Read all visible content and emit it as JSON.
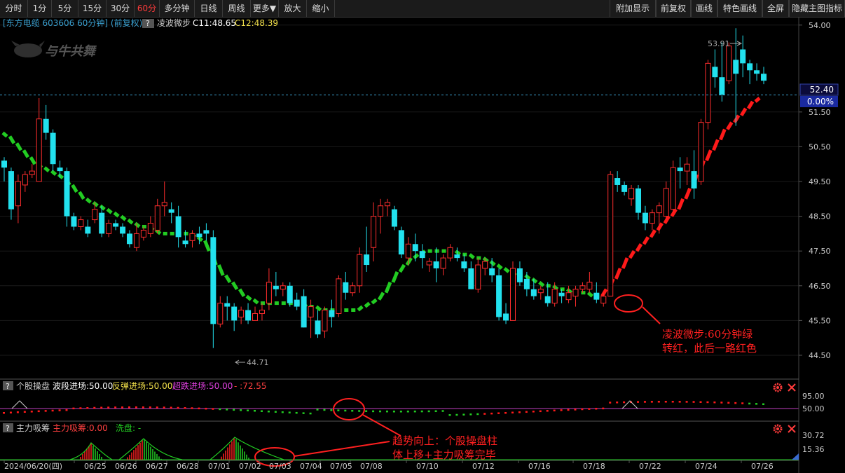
{
  "toolbar": {
    "left": [
      "分时",
      "1分",
      "5分",
      "15分",
      "30分",
      "60分",
      "多分钟",
      "日线",
      "周线",
      "更多▼",
      "放大",
      "缩小"
    ],
    "active": "60分",
    "right": [
      "附加显示",
      "前复权",
      "画线",
      "特色画线",
      "全屏",
      "隐藏主图指标"
    ]
  },
  "colors": {
    "up": "#ff2d2d",
    "down": "#22e1ee",
    "indicator_red": "#ff1a1a",
    "indicator_green": "#22cc22",
    "price_line": "#3aa0d0",
    "background": "#000000"
  },
  "main_header": {
    "stock": "[东方电缆 603606 60分钟] (前复权)",
    "help": "?",
    "indicator": "凌波微步",
    "c1": "C11:48.65",
    "c2": "C12:48.39"
  },
  "watermark": "与牛共舞",
  "price_axis": {
    "ticks": [
      "54.00",
      "51.50",
      "50.50",
      "49.50",
      "48.50",
      "47.50",
      "46.50",
      "45.50",
      "44.50"
    ]
  },
  "last_price": {
    "value": "52.40",
    "change": "0.00%"
  },
  "annotations": {
    "high": "53.91",
    "low": "44.71",
    "note1_line1": "凌波微步:60分钟绿",
    "note1_line2": "转红，此后一路红色",
    "note2_line1": "趋势向上：个股操盘柱",
    "note2_line2": "体上移+主力吸筹完毕"
  },
  "panel2": {
    "help": "?",
    "name": "个股操盘",
    "t1": "波段进场:50.00",
    "t2": "反弹进场:50.00",
    "t3": "超跌进场:50.00",
    "t4": "- :72.55",
    "tick1": "95.00",
    "tick2": "50.00"
  },
  "panel3": {
    "help": "?",
    "name": "主力吸筹",
    "t1": "主力吸筹:0.00",
    "t2": "洗盘: -",
    "tick1": "30.72",
    "tick2": "15.36"
  },
  "dates": [
    "2024/06/20(四)",
    "06/25",
    "06/26",
    "06/27",
    "06/28",
    "07/01",
    "07/02",
    "07/03",
    "07/04",
    "07/05",
    "07/08",
    "07/10",
    "07/12",
    "07/16",
    "07/18",
    "07/22",
    "07/24",
    "07/26"
  ],
  "chart_data": {
    "type": "candlestick",
    "title": "东方电缆 603606 60分钟",
    "ylim": [
      44.0,
      54.5
    ],
    "candles": [
      [
        50.1,
        50.2,
        49.5,
        49.9
      ],
      [
        49.8,
        49.9,
        48.4,
        48.7
      ],
      [
        48.8,
        49.7,
        48.3,
        49.5
      ],
      [
        49.4,
        49.8,
        49.2,
        49.7
      ],
      [
        49.7,
        50.0,
        49.6,
        49.8
      ],
      [
        49.5,
        51.9,
        49.5,
        51.3
      ],
      [
        51.3,
        51.7,
        50.7,
        50.9
      ],
      [
        50.9,
        51.0,
        49.8,
        50.0
      ],
      [
        49.9,
        50.1,
        49.6,
        49.8
      ],
      [
        49.8,
        49.9,
        48.2,
        48.5
      ],
      [
        48.5,
        48.6,
        48.1,
        48.2
      ],
      [
        48.2,
        48.5,
        48.1,
        48.4
      ],
      [
        48.2,
        48.4,
        47.9,
        48.0
      ],
      [
        48.4,
        48.9,
        48.3,
        48.7
      ],
      [
        48.6,
        48.8,
        47.9,
        48.0
      ],
      [
        48.0,
        48.4,
        47.9,
        48.3
      ],
      [
        48.3,
        48.4,
        48.1,
        48.2
      ],
      [
        48.2,
        48.3,
        47.9,
        48.0
      ],
      [
        48.0,
        48.1,
        47.6,
        47.7
      ],
      [
        47.6,
        48.3,
        47.5,
        48.0
      ],
      [
        47.9,
        48.2,
        47.8,
        48.1
      ],
      [
        48.0,
        48.5,
        47.9,
        48.3
      ],
      [
        48.1,
        49.0,
        48.0,
        48.8
      ],
      [
        48.8,
        49.5,
        48.5,
        48.9
      ],
      [
        48.7,
        48.9,
        48.3,
        48.6
      ],
      [
        48.5,
        48.8,
        47.6,
        47.9
      ],
      [
        47.8,
        48.1,
        47.6,
        47.7
      ],
      [
        47.8,
        48.1,
        47.6,
        48.0
      ],
      [
        48.0,
        48.2,
        47.7,
        47.9
      ],
      [
        48.1,
        48.3,
        47.8,
        48.0
      ],
      [
        47.9,
        48.1,
        44.71,
        45.4
      ],
      [
        45.4,
        46.2,
        45.3,
        46.0
      ],
      [
        46.0,
        46.2,
        45.5,
        45.9
      ],
      [
        45.9,
        46.0,
        45.2,
        45.5
      ],
      [
        45.6,
        45.9,
        45.4,
        45.8
      ],
      [
        45.8,
        46.0,
        45.4,
        45.5
      ],
      [
        45.5,
        45.9,
        45.5,
        45.7
      ],
      [
        45.7,
        46.0,
        45.5,
        45.8
      ],
      [
        46.0,
        47.0,
        45.8,
        46.6
      ],
      [
        46.5,
        46.9,
        46.2,
        46.4
      ],
      [
        46.4,
        46.6,
        46.2,
        46.5
      ],
      [
        46.5,
        46.6,
        45.9,
        46.0
      ],
      [
        46.1,
        46.3,
        45.8,
        45.9
      ],
      [
        46.2,
        46.4,
        45.3,
        45.3
      ],
      [
        45.6,
        46.1,
        45.0,
        45.9
      ],
      [
        45.5,
        45.8,
        45.0,
        45.1
      ],
      [
        45.2,
        45.9,
        45.0,
        45.8
      ],
      [
        45.8,
        46.1,
        45.3,
        45.6
      ],
      [
        45.7,
        46.8,
        45.6,
        46.7
      ],
      [
        46.6,
        46.9,
        46.1,
        46.3
      ],
      [
        46.3,
        46.6,
        46.2,
        46.5
      ],
      [
        46.5,
        47.6,
        46.3,
        47.4
      ],
      [
        47.4,
        48.2,
        46.9,
        47.1
      ],
      [
        47.6,
        48.9,
        47.2,
        48.5
      ],
      [
        48.5,
        49.0,
        48.0,
        48.8
      ],
      [
        48.8,
        49.0,
        48.5,
        48.9
      ],
      [
        48.7,
        48.8,
        48.1,
        48.2
      ],
      [
        48.1,
        48.2,
        47.3,
        47.4
      ],
      [
        47.3,
        47.9,
        47.1,
        47.7
      ],
      [
        47.7,
        48.0,
        47.2,
        47.5
      ],
      [
        47.5,
        47.7,
        47.0,
        47.3
      ],
      [
        47.1,
        47.3,
        46.9,
        47.2
      ],
      [
        47.2,
        47.6,
        46.6,
        47.0
      ],
      [
        47.0,
        47.4,
        46.8,
        47.3
      ],
      [
        47.3,
        47.7,
        47.2,
        47.6
      ],
      [
        47.4,
        47.6,
        47.2,
        47.3
      ],
      [
        47.2,
        47.4,
        46.9,
        47.0
      ],
      [
        47.0,
        47.2,
        46.4,
        46.4
      ],
      [
        46.4,
        47.3,
        46.3,
        47.1
      ],
      [
        47.0,
        47.3,
        46.8,
        47.2
      ],
      [
        47.0,
        47.3,
        46.6,
        46.8
      ],
      [
        46.8,
        47.0,
        45.5,
        45.6
      ],
      [
        45.7,
        46.0,
        45.4,
        45.5
      ],
      [
        45.5,
        47.2,
        45.5,
        47.0
      ],
      [
        47.0,
        47.2,
        46.5,
        46.6
      ],
      [
        46.7,
        46.9,
        46.2,
        46.4
      ],
      [
        46.4,
        46.7,
        46.1,
        46.2
      ],
      [
        46.3,
        46.5,
        46.1,
        46.4
      ],
      [
        46.2,
        46.6,
        45.9,
        46.0
      ],
      [
        46.0,
        46.6,
        45.9,
        46.4
      ],
      [
        46.3,
        46.4,
        46.0,
        46.2
      ],
      [
        46.1,
        46.5,
        46.0,
        46.3
      ],
      [
        46.2,
        46.5,
        45.9,
        46.4
      ],
      [
        46.4,
        46.6,
        46.3,
        46.5
      ],
      [
        46.4,
        46.9,
        46.3,
        46.6
      ],
      [
        46.3,
        46.6,
        46.0,
        46.1
      ],
      [
        46.0,
        46.3,
        45.9,
        46.2
      ],
      [
        46.2,
        49.8,
        46.2,
        49.7
      ],
      [
        49.6,
        49.8,
        49.2,
        49.4
      ],
      [
        49.4,
        49.5,
        49.1,
        49.2
      ],
      [
        49.0,
        49.4,
        48.8,
        49.3
      ],
      [
        49.3,
        49.4,
        48.4,
        48.6
      ],
      [
        48.6,
        48.8,
        48.1,
        48.3
      ],
      [
        48.3,
        48.7,
        48.1,
        48.6
      ],
      [
        48.6,
        48.9,
        48.0,
        48.8
      ],
      [
        48.5,
        49.5,
        48.4,
        49.3
      ],
      [
        48.7,
        50.1,
        48.6,
        49.9
      ],
      [
        49.9,
        50.2,
        49.3,
        49.8
      ],
      [
        49.8,
        50.2,
        49.4,
        50.0
      ],
      [
        49.8,
        50.4,
        49.0,
        49.3
      ],
      [
        49.5,
        51.3,
        49.4,
        51.2
      ],
      [
        51.2,
        53.0,
        51.0,
        52.9
      ],
      [
        52.8,
        53.3,
        52.2,
        52.5
      ],
      [
        52.5,
        53.5,
        51.8,
        52.0
      ],
      [
        52.4,
        53.5,
        52.3,
        53.4
      ],
      [
        53.0,
        53.91,
        51.1,
        52.6
      ],
      [
        53.3,
        53.7,
        52.5,
        52.9
      ],
      [
        52.9,
        53.0,
        52.3,
        52.7
      ],
      [
        52.7,
        52.9,
        52.4,
        52.6
      ],
      [
        52.6,
        52.8,
        52.3,
        52.4
      ]
    ],
    "ma_line": [
      50.9,
      50.8,
      50.6,
      50.4,
      50.2,
      50.0,
      49.9,
      49.8,
      49.7,
      49.6,
      49.4,
      49.2,
      49.0,
      48.9,
      48.8,
      48.7,
      48.6,
      48.5,
      48.4,
      48.3,
      48.2,
      48.2,
      48.1,
      48.0,
      48.0,
      48.0,
      48.0,
      48.0,
      47.9,
      47.8,
      47.5,
      47.1,
      46.8,
      46.6,
      46.4,
      46.2,
      46.1,
      46.0,
      46.0,
      46.0,
      46.0,
      46.0,
      46.0,
      46.0,
      45.9,
      45.9,
      45.8,
      45.8,
      45.8,
      45.8,
      45.8,
      45.8,
      45.9,
      46.0,
      46.1,
      46.3,
      46.6,
      46.9,
      47.1,
      47.3,
      47.4,
      47.5,
      47.5,
      47.5,
      47.5,
      47.5,
      47.4,
      47.4,
      47.3,
      47.3,
      47.2,
      47.1,
      47.0,
      46.9,
      46.8,
      46.8,
      46.7,
      46.6,
      46.5,
      46.5,
      46.4,
      46.4,
      46.3,
      46.3,
      46.3,
      46.2,
      46.2,
      46.4,
      46.7,
      47.0,
      47.3,
      47.5,
      47.7,
      47.9,
      48.1,
      48.3,
      48.5,
      48.7,
      49.0,
      49.3,
      49.7,
      50.1,
      50.4,
      50.7,
      51.0,
      51.2,
      51.4,
      51.6,
      51.8,
      51.9
    ],
    "ma_color": "green until candle 86, red afterwards"
  }
}
